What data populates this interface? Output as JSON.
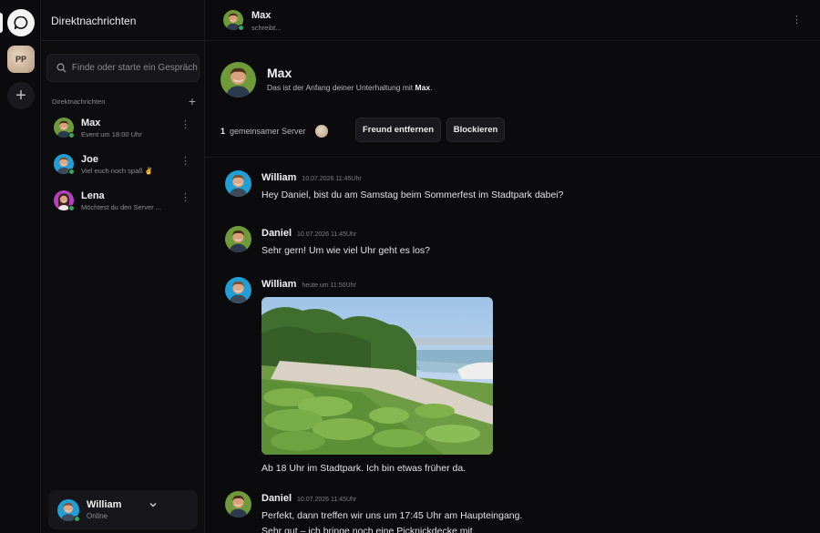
{
  "rail": {
    "server_initials": "PP"
  },
  "sidebar": {
    "title": "Direktnachrichten",
    "search_placeholder": "Finde oder starte ein Gespräch",
    "section_label": "Direktnachrichten",
    "conversations": [
      {
        "name": "Max",
        "preview": "Event um 18:00 Uhr",
        "status": "online"
      },
      {
        "name": "Joe",
        "preview": "Viel euch noch spaß ✌️",
        "status": "online"
      },
      {
        "name": "Lena",
        "preview": "Möchtest du den Server ...",
        "status": "online"
      }
    ]
  },
  "user": {
    "name": "William",
    "status": "Online"
  },
  "chat": {
    "partner_name": "Max",
    "partner_status": "schreibt...",
    "intro_name": "Max",
    "intro_text_prefix": "Das ist der Anfang deiner Unterhaltung mit",
    "intro_text_name": "Max",
    "intro_text_suffix": ".",
    "shared_count": "1",
    "shared_label": "gemeinsamer Server",
    "remove_friend_label": "Freund entfernen",
    "block_label": "Blockieren"
  },
  "messages": [
    {
      "author": "William",
      "time": "10.07.2026 11:45Uhr",
      "text": "Hey Daniel, bist du am Samstag beim Sommerfest im Stadtpark dabei?"
    },
    {
      "author": "Daniel",
      "time": "10.07.2026 11:45Uhr",
      "text": "Sehr gern! Um wie viel Uhr geht es los?"
    },
    {
      "author": "William",
      "time": "heute um 11:50Uhr",
      "text": "Ab 18 Uhr im Stadtpark. Ich bin etwas früher da."
    },
    {
      "author": "Daniel",
      "time": "10.07.2026 11:45Uhr",
      "text": "Perfekt, dann treffen wir uns um 17:45 Uhr am Haupteingang.",
      "text2": "Sehr gut – ich bringe noch eine Picknickdecke mit."
    }
  ],
  "colors": {
    "background": "#0b0b0d",
    "panel": "#17171b",
    "online": "#3ba55d"
  }
}
